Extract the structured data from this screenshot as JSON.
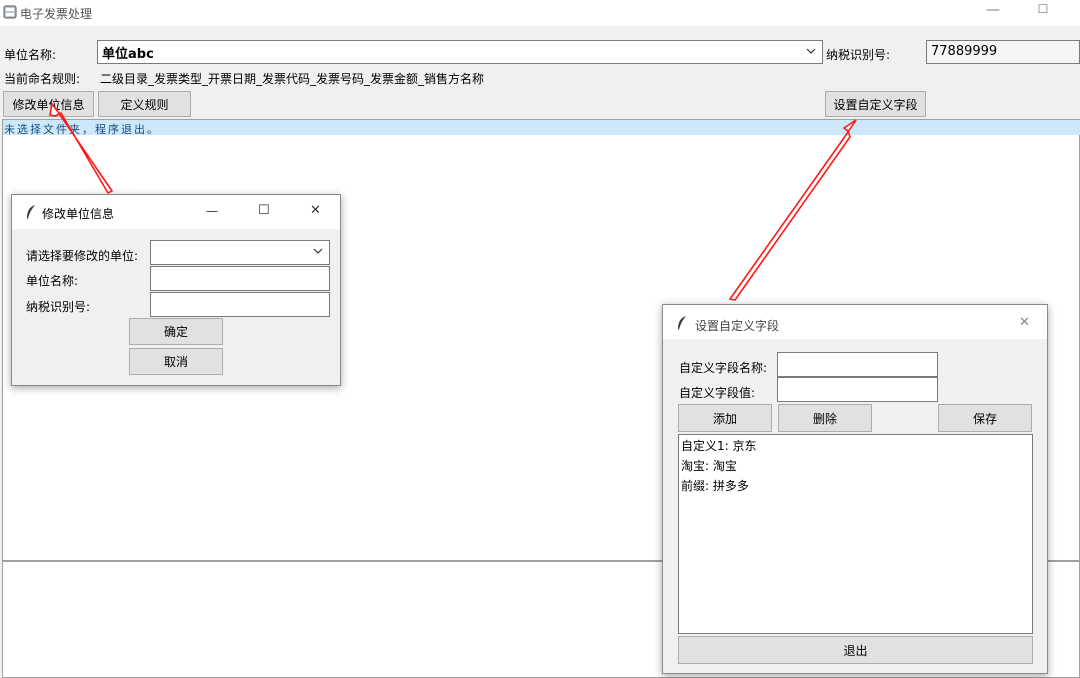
{
  "window": {
    "title": "电子发票处理",
    "minimize_glyph": "—",
    "maximize_glyph": "☐"
  },
  "main": {
    "unit_name_label": "单位名称:",
    "unit_name_value": "单位abc",
    "tax_id_label": "纳税识别号:",
    "tax_id_value": "77889999",
    "rule_label": "当前命名规则:",
    "rule_value": "二级目录_发票类型_开票日期_发票代码_发票号码_发票金额_销售方名称",
    "buttons": {
      "modify_unit": "修改单位信息",
      "define_rule": "定义规则",
      "custom_fields": "设置自定义字段"
    },
    "log_text": "未选择文件夹，程序退出。"
  },
  "modify_dialog": {
    "title": "修改单位信息",
    "select_unit_label": "请选择要修改的单位:",
    "select_unit_value": "",
    "unit_name_label": "单位名称:",
    "unit_name_value": "",
    "tax_id_label": "纳税识别号:",
    "tax_id_value": "",
    "confirm": "确定",
    "cancel": "取消",
    "minimize_glyph": "—",
    "maximize_glyph": "☐",
    "close_glyph": "✕"
  },
  "custom_dialog": {
    "title": "设置自定义字段",
    "field_name_label": "自定义字段名称:",
    "field_name_value": "",
    "field_value_label": "自定义字段值:",
    "field_value_value": "",
    "add": "添加",
    "delete": "删除",
    "save": "保存",
    "items": [
      "自定义1: 京东",
      "淘宝: 淘宝",
      "前缀: 拼多多"
    ],
    "exit": "退出",
    "close_glyph": "✕"
  },
  "colors": {
    "highlight": "#cde8fb",
    "arrow": "#ff1a1a"
  }
}
